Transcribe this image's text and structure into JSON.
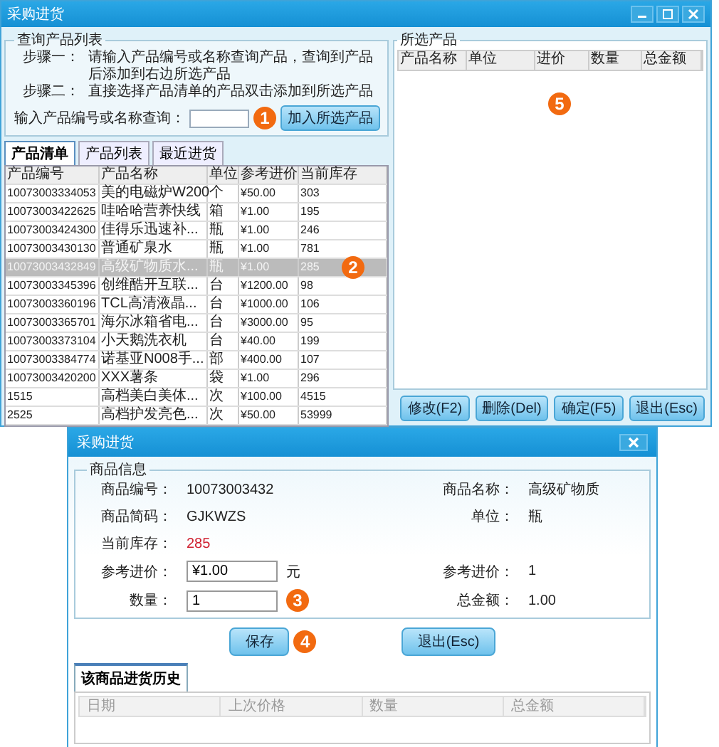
{
  "main_window": {
    "title": "采购进货",
    "query_group": {
      "title": "查询产品列表",
      "steps": [
        {
          "label": "步骤一：",
          "text": "请输入产品编号或名称查询产品，查询到产品后添加到右边所选产品"
        },
        {
          "label": "步骤二：",
          "text": "直接选择产品清单的产品双击添加到所选产品"
        }
      ],
      "search_label": "输入产品编号或名称查询：",
      "add_button": "加入所选产品"
    },
    "tabs": [
      {
        "label": "产品清单",
        "selected": true
      },
      {
        "label": "产品列表",
        "selected": false
      },
      {
        "label": "最近进货",
        "selected": false
      }
    ],
    "product_table": {
      "columns": [
        "产品编号",
        "产品名称",
        "单位",
        "参考进价",
        "当前库存"
      ],
      "rows": [
        {
          "selected": false,
          "cells": [
            "10073003334053",
            "美的电磁炉W200",
            "个",
            "¥50.00",
            "303"
          ]
        },
        {
          "selected": false,
          "cells": [
            "10073003422625",
            "哇哈哈营养快线",
            "箱",
            "¥1.00",
            "195"
          ]
        },
        {
          "selected": false,
          "cells": [
            "10073003424300",
            "佳得乐迅速补...",
            "瓶",
            "¥1.00",
            "246"
          ]
        },
        {
          "selected": false,
          "cells": [
            "10073003430130",
            "普通矿泉水",
            "瓶",
            "¥1.00",
            "781"
          ]
        },
        {
          "selected": true,
          "cells": [
            "10073003432849",
            "高级矿物质水...",
            "瓶",
            "¥1.00",
            "285"
          ]
        },
        {
          "selected": false,
          "cells": [
            "10073003345396",
            "创维酷开互联...",
            "台",
            "¥1200.00",
            "98"
          ]
        },
        {
          "selected": false,
          "cells": [
            "10073003360196",
            "TCL高清液晶...",
            "台",
            "¥1000.00",
            "106"
          ]
        },
        {
          "selected": false,
          "cells": [
            "10073003365701",
            "海尔冰箱省电...",
            "台",
            "¥3000.00",
            "95"
          ]
        },
        {
          "selected": false,
          "cells": [
            "10073003373104",
            "小天鹅洗衣机",
            "台",
            "¥40.00",
            "199"
          ]
        },
        {
          "selected": false,
          "cells": [
            "10073003384774",
            "诺基亚N008手...",
            "部",
            "¥400.00",
            "107"
          ]
        },
        {
          "selected": false,
          "cells": [
            "10073003420200",
            "XXX薯条",
            "袋",
            "¥1.00",
            "296"
          ]
        },
        {
          "selected": false,
          "cells": [
            "1515",
            "高档美白美体...",
            "次",
            "¥100.00",
            "4515"
          ]
        },
        {
          "selected": false,
          "cells": [
            "2525",
            "高档护发亮色...",
            "次",
            "¥50.00",
            "53999"
          ]
        }
      ]
    },
    "selected_group": {
      "title": "所选产品",
      "columns": [
        "产品名称",
        "单位",
        "进价",
        "数量",
        "总金额"
      ]
    },
    "buttons": [
      "修改(F2)",
      "删除(Del)",
      "确定(F5)",
      "退出(Esc)"
    ]
  },
  "dialog": {
    "title": "采购进货",
    "group_title": "商品信息",
    "code_label": "商品编号：",
    "code": "10073003432",
    "name_label": "商品名称：",
    "name": "高级矿物质",
    "short_label": "商品简码：",
    "short": "GJKWZS",
    "unit_label": "单位：",
    "unit": "瓶",
    "stock_label": "当前库存：",
    "stock": "285",
    "price_label": "参考进价：",
    "price": "¥1.00",
    "currency": "元",
    "ref_label": "参考进价：",
    "ref": "1",
    "qty_label": "数量：",
    "qty": "1",
    "total_label": "总金额：",
    "total": "1.00",
    "buttons": [
      "保存",
      "退出(Esc)"
    ],
    "history_tab": {
      "label": "该商品进货历史",
      "selected": true
    },
    "history_columns": [
      "日期",
      "上次价格",
      "数量",
      "总金额"
    ]
  },
  "markers": [
    {
      "label": "1"
    },
    {
      "label": "2"
    },
    {
      "label": "3"
    },
    {
      "label": "4"
    },
    {
      "label": "5"
    }
  ]
}
